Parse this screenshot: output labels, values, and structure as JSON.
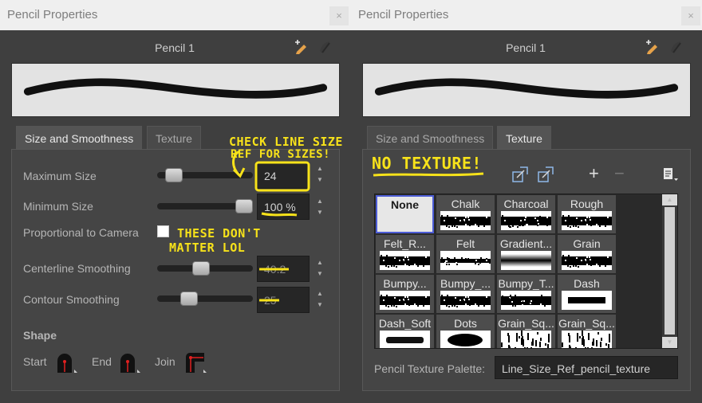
{
  "left": {
    "title": "Pencil Properties",
    "close_glyph": "×",
    "pencil_name": "Pencil 1",
    "icons": [
      "new-pencil-icon",
      "pencil-style-icon"
    ],
    "tabs": [
      {
        "label": "Size and Smoothness",
        "active": true
      },
      {
        "label": "Texture",
        "active": false
      }
    ],
    "fields": {
      "max_size": {
        "label": "Maximum Size",
        "value": "24",
        "slider": 0.1
      },
      "min_size": {
        "label": "Minimum Size",
        "value": "100 %",
        "slider": 1.0
      },
      "proportional": {
        "label": "Proportional to Camera",
        "checked": false
      },
      "centerline": {
        "label": "Centerline Smoothing",
        "value": "40.2",
        "slider": 0.45
      },
      "contour": {
        "label": "Contour Smoothing",
        "value": "25",
        "slider": 0.3
      }
    },
    "shape": {
      "title": "Shape",
      "start": "Start",
      "end": "End",
      "join": "Join"
    }
  },
  "right": {
    "title": "Pencil Properties",
    "close_glyph": "×",
    "pencil_name": "Pencil 1",
    "tabs": [
      {
        "label": "Size and Smoothness",
        "active": false
      },
      {
        "label": "Texture",
        "active": true
      }
    ],
    "toolbar": {
      "plus": "+",
      "minus": "−"
    },
    "textures": [
      {
        "name": "None",
        "selected": true
      },
      {
        "name": "Chalk"
      },
      {
        "name": "Charcoal"
      },
      {
        "name": "Rough"
      },
      {
        "name": "Felt_R..."
      },
      {
        "name": "Felt"
      },
      {
        "name": "Gradient..."
      },
      {
        "name": "Grain"
      },
      {
        "name": "Bumpy..."
      },
      {
        "name": "Bumpy_..."
      },
      {
        "name": "Bumpy_T..."
      },
      {
        "name": "Dash"
      },
      {
        "name": "Dash_Soft"
      },
      {
        "name": "Dots"
      },
      {
        "name": "Grain_Sq..."
      },
      {
        "name": "Grain_Sq..."
      }
    ],
    "palette_label": "Pencil Texture Palette:",
    "palette_value": "Line_Size_Ref_pencil_texture"
  },
  "annotations": {
    "note1_line1": "CHECK LINE SIZE",
    "note1_line2": "REF FOR SIZES!",
    "note2_line1": "THESE DON'T",
    "note2_line2": "MATTER LOL",
    "note3": "NO TEXTURE!",
    "color": "#f7e21a"
  }
}
